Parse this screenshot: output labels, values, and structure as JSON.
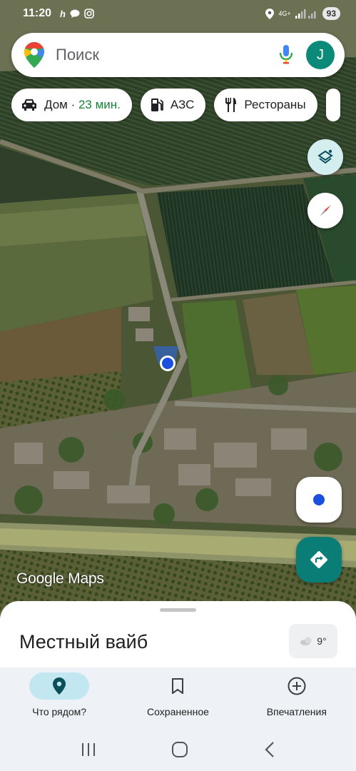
{
  "status_bar": {
    "time": "11:20",
    "network_label": "4G+",
    "battery": "93"
  },
  "search": {
    "placeholder": "Поиск",
    "avatar_letter": "J"
  },
  "chips": [
    {
      "label": "Дом",
      "eta": "23 мин.",
      "icon": "car-icon"
    },
    {
      "label": "АЗС",
      "icon": "gas-station-icon"
    },
    {
      "label": "Рестораны",
      "icon": "restaurant-icon"
    }
  ],
  "map": {
    "attribution": "Google Maps",
    "controls": [
      "layers-icon",
      "compass-icon",
      "my-location-icon",
      "directions-icon"
    ]
  },
  "sheet": {
    "title": "Местный вайб",
    "weather_temp": "9°"
  },
  "bottom_nav": {
    "items": [
      {
        "label": "Что рядом?",
        "icon": "pin-icon",
        "active": true
      },
      {
        "label": "Сохраненное",
        "icon": "bookmark-icon",
        "active": false
      },
      {
        "label": "Впечатления",
        "icon": "plus-circle-icon",
        "active": false
      }
    ]
  },
  "colors": {
    "accent": "#0b7d77",
    "eta_green": "#188038",
    "active_nav": "#c2e7f0",
    "location_blue": "#1a4fe0"
  }
}
